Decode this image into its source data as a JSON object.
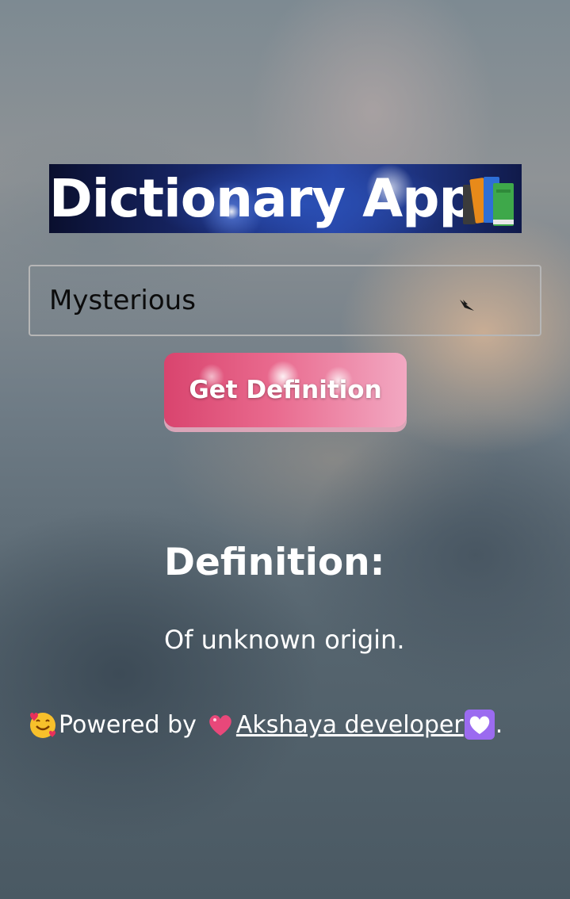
{
  "app": {
    "title": "Dictionary App",
    "title_icon": "books-icon"
  },
  "search": {
    "value": "Mysterious",
    "placeholder": ""
  },
  "actions": {
    "get_definition_label": "Get Definition"
  },
  "result": {
    "heading": "Definition:",
    "text": "Of unknown origin."
  },
  "footer": {
    "prefix": "Powered by",
    "link_label": " Akshaya developer ",
    "suffix": ".",
    "prefix_icon": "smiling-hearts-emoji-icon",
    "link_icon_left": "heart-emoji-icon",
    "link_icon_right": "white-heart-emoji-icon"
  },
  "colors": {
    "button_pink": "#e96a8e",
    "title_bg": "#1b2d78",
    "text_white": "#ffffff"
  }
}
